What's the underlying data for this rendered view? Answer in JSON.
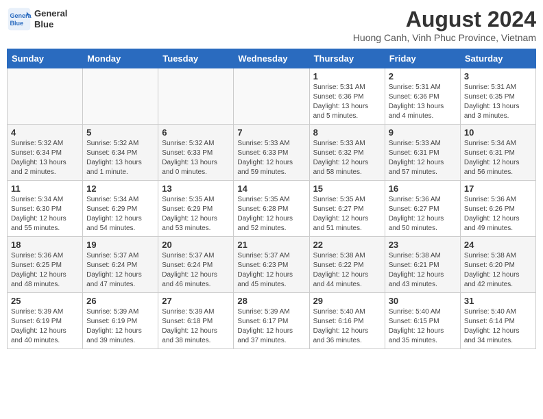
{
  "header": {
    "logo_line1": "General",
    "logo_line2": "Blue",
    "title": "August 2024",
    "subtitle": "Huong Canh, Vinh Phuc Province, Vietnam"
  },
  "weekdays": [
    "Sunday",
    "Monday",
    "Tuesday",
    "Wednesday",
    "Thursday",
    "Friday",
    "Saturday"
  ],
  "weeks": [
    [
      {
        "day": "",
        "info": ""
      },
      {
        "day": "",
        "info": ""
      },
      {
        "day": "",
        "info": ""
      },
      {
        "day": "",
        "info": ""
      },
      {
        "day": "1",
        "info": "Sunrise: 5:31 AM\nSunset: 6:36 PM\nDaylight: 13 hours\nand 5 minutes."
      },
      {
        "day": "2",
        "info": "Sunrise: 5:31 AM\nSunset: 6:36 PM\nDaylight: 13 hours\nand 4 minutes."
      },
      {
        "day": "3",
        "info": "Sunrise: 5:31 AM\nSunset: 6:35 PM\nDaylight: 13 hours\nand 3 minutes."
      }
    ],
    [
      {
        "day": "4",
        "info": "Sunrise: 5:32 AM\nSunset: 6:34 PM\nDaylight: 13 hours\nand 2 minutes."
      },
      {
        "day": "5",
        "info": "Sunrise: 5:32 AM\nSunset: 6:34 PM\nDaylight: 13 hours\nand 1 minute."
      },
      {
        "day": "6",
        "info": "Sunrise: 5:32 AM\nSunset: 6:33 PM\nDaylight: 13 hours\nand 0 minutes."
      },
      {
        "day": "7",
        "info": "Sunrise: 5:33 AM\nSunset: 6:33 PM\nDaylight: 12 hours\nand 59 minutes."
      },
      {
        "day": "8",
        "info": "Sunrise: 5:33 AM\nSunset: 6:32 PM\nDaylight: 12 hours\nand 58 minutes."
      },
      {
        "day": "9",
        "info": "Sunrise: 5:33 AM\nSunset: 6:31 PM\nDaylight: 12 hours\nand 57 minutes."
      },
      {
        "day": "10",
        "info": "Sunrise: 5:34 AM\nSunset: 6:31 PM\nDaylight: 12 hours\nand 56 minutes."
      }
    ],
    [
      {
        "day": "11",
        "info": "Sunrise: 5:34 AM\nSunset: 6:30 PM\nDaylight: 12 hours\nand 55 minutes."
      },
      {
        "day": "12",
        "info": "Sunrise: 5:34 AM\nSunset: 6:29 PM\nDaylight: 12 hours\nand 54 minutes."
      },
      {
        "day": "13",
        "info": "Sunrise: 5:35 AM\nSunset: 6:29 PM\nDaylight: 12 hours\nand 53 minutes."
      },
      {
        "day": "14",
        "info": "Sunrise: 5:35 AM\nSunset: 6:28 PM\nDaylight: 12 hours\nand 52 minutes."
      },
      {
        "day": "15",
        "info": "Sunrise: 5:35 AM\nSunset: 6:27 PM\nDaylight: 12 hours\nand 51 minutes."
      },
      {
        "day": "16",
        "info": "Sunrise: 5:36 AM\nSunset: 6:27 PM\nDaylight: 12 hours\nand 50 minutes."
      },
      {
        "day": "17",
        "info": "Sunrise: 5:36 AM\nSunset: 6:26 PM\nDaylight: 12 hours\nand 49 minutes."
      }
    ],
    [
      {
        "day": "18",
        "info": "Sunrise: 5:36 AM\nSunset: 6:25 PM\nDaylight: 12 hours\nand 48 minutes."
      },
      {
        "day": "19",
        "info": "Sunrise: 5:37 AM\nSunset: 6:24 PM\nDaylight: 12 hours\nand 47 minutes."
      },
      {
        "day": "20",
        "info": "Sunrise: 5:37 AM\nSunset: 6:24 PM\nDaylight: 12 hours\nand 46 minutes."
      },
      {
        "day": "21",
        "info": "Sunrise: 5:37 AM\nSunset: 6:23 PM\nDaylight: 12 hours\nand 45 minutes."
      },
      {
        "day": "22",
        "info": "Sunrise: 5:38 AM\nSunset: 6:22 PM\nDaylight: 12 hours\nand 44 minutes."
      },
      {
        "day": "23",
        "info": "Sunrise: 5:38 AM\nSunset: 6:21 PM\nDaylight: 12 hours\nand 43 minutes."
      },
      {
        "day": "24",
        "info": "Sunrise: 5:38 AM\nSunset: 6:20 PM\nDaylight: 12 hours\nand 42 minutes."
      }
    ],
    [
      {
        "day": "25",
        "info": "Sunrise: 5:39 AM\nSunset: 6:19 PM\nDaylight: 12 hours\nand 40 minutes."
      },
      {
        "day": "26",
        "info": "Sunrise: 5:39 AM\nSunset: 6:19 PM\nDaylight: 12 hours\nand 39 minutes."
      },
      {
        "day": "27",
        "info": "Sunrise: 5:39 AM\nSunset: 6:18 PM\nDaylight: 12 hours\nand 38 minutes."
      },
      {
        "day": "28",
        "info": "Sunrise: 5:39 AM\nSunset: 6:17 PM\nDaylight: 12 hours\nand 37 minutes."
      },
      {
        "day": "29",
        "info": "Sunrise: 5:40 AM\nSunset: 6:16 PM\nDaylight: 12 hours\nand 36 minutes."
      },
      {
        "day": "30",
        "info": "Sunrise: 5:40 AM\nSunset: 6:15 PM\nDaylight: 12 hours\nand 35 minutes."
      },
      {
        "day": "31",
        "info": "Sunrise: 5:40 AM\nSunset: 6:14 PM\nDaylight: 12 hours\nand 34 minutes."
      }
    ]
  ]
}
